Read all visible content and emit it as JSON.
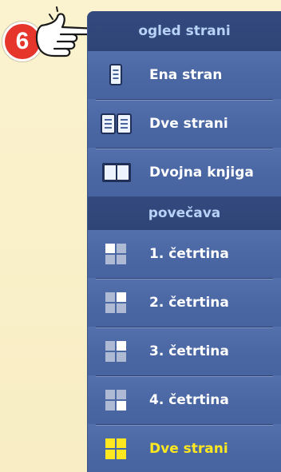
{
  "step_badge": "6",
  "sections": [
    {
      "title": "ogled strani",
      "items": [
        {
          "label": "Ena stran",
          "icon": "single-page-icon"
        },
        {
          "label": "Dve strani",
          "icon": "two-pages-icon"
        },
        {
          "label": "Dvojna knjiga",
          "icon": "double-book-icon"
        }
      ]
    },
    {
      "title": "povečava",
      "items": [
        {
          "label": "1. četrtina",
          "icon": "quarter-1-icon"
        },
        {
          "label": "2. četrtina",
          "icon": "quarter-2-icon"
        },
        {
          "label": "3. četrtina",
          "icon": "quarter-3-icon"
        },
        {
          "label": "4. četrtina",
          "icon": "quarter-4-icon"
        },
        {
          "label": "Dve strani",
          "icon": "zoom-two-pages-icon",
          "active": true
        }
      ]
    }
  ],
  "colors": {
    "panel": "#4b659f",
    "header_bg": "#2f4476",
    "header_text": "#b7d2f7",
    "label": "#ffffff",
    "active_label": "#ffe81f",
    "badge": "#e6352b"
  }
}
